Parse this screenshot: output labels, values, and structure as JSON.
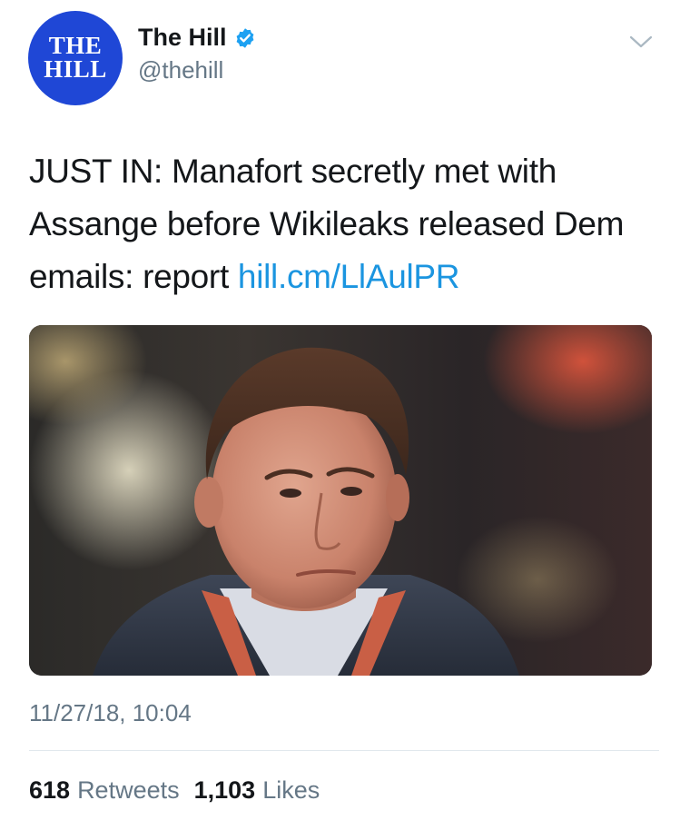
{
  "user": {
    "avatar_logo_lines": [
      "THE",
      "HILL"
    ],
    "display_name": "The Hill",
    "handle": "@thehill",
    "verified": true
  },
  "tweet": {
    "text": "JUST IN: Manafort secretly met with Assange before Wikileaks released Dem emails: report ",
    "link": "hill.cm/LlAulPR",
    "timestamp": "11/27/18, 10:04"
  },
  "stats": {
    "retweets_count": "618",
    "retweets_label": "Retweets",
    "likes_count": "1,103",
    "likes_label": "Likes"
  },
  "colors": {
    "avatar_bg": "#1f47d6",
    "link": "#1b95e0",
    "secondary_text": "#657786",
    "verified": "#1da1f2"
  },
  "icons": [
    "verified-icon",
    "chevron-down-icon"
  ]
}
